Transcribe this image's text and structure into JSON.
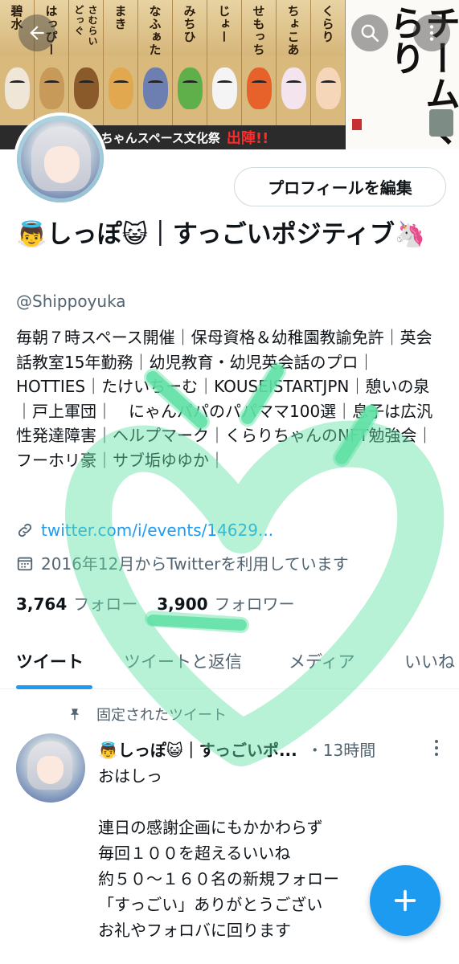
{
  "banner": {
    "names": [
      "碧水",
      "はっぴー",
      "さむらいどっぐ",
      "まき",
      "なふぁた",
      "みちひ",
      "じょー",
      "せもっち",
      "ちょこあ",
      "くらり"
    ],
    "colors": [
      "#f0e6d8",
      "#c89a5a",
      "#8a5a2a",
      "#e2a84f",
      "#6d7fb0",
      "#5fb04a",
      "#f4f4f4",
      "#e7622a",
      "#f4e4ee",
      "#f5d6b9"
    ],
    "strip_text": "おじちゃんスペース文化祭",
    "strip_highlight": "出陣!!",
    "calligraphy": "チームくらり"
  },
  "nav": {
    "back_icon": "back-arrow-icon",
    "search_icon": "search-icon",
    "more_icon": "more-vertical-icon"
  },
  "profile": {
    "edit_button": "プロフィールを編集",
    "display_name": "👼しっぽ😺｜すっごいポジティブ🦄",
    "handle": "@Shippoyuka",
    "bio": "毎朝７時スペース開催｜保母資格＆幼稚園教諭免許｜英会話教室15年勤務｜幼児教育・幼児英会話のプロ｜HOTTIES｜たけいちーむ｜KOUSEISTARTJPN｜憩いの泉｜戸上軍団｜　にゃんパパのパパママ100選｜息子は広汎性発達障害｜ヘルプマーク｜くらりちゃんのNFT勉強会｜フーホリ豪｜サブ垢ゆゆか｜",
    "link": "twitter.com/i/events/14629...",
    "joined": "2016年12月からTwitterを利用しています",
    "following_count": "3,764",
    "following_label": "フォロー",
    "followers_count": "3,900",
    "followers_label": "フォロワー"
  },
  "tabs": [
    "ツイート",
    "ツイートと返信",
    "メディア",
    "いいね"
  ],
  "pinned_tweet": {
    "pinned_label": "固定されたツイート",
    "author": "👼しっぽ😺｜すっごいポ...",
    "time": "・13時間",
    "text": "おはしっ\n\n連日の感謝企画にもかかわらず\n毎回１００を超えるいいね\n約５０〜１６０名の新規フォロー\n「すっごい」ありがとうござい\nお礼やフォロバに回ります"
  },
  "fab": {
    "icon": "plus-icon"
  },
  "colors": {
    "accent": "#1d9bf0",
    "text_primary": "#0f1419",
    "text_secondary": "#536471",
    "overlay_green": "#5fe0a5"
  }
}
